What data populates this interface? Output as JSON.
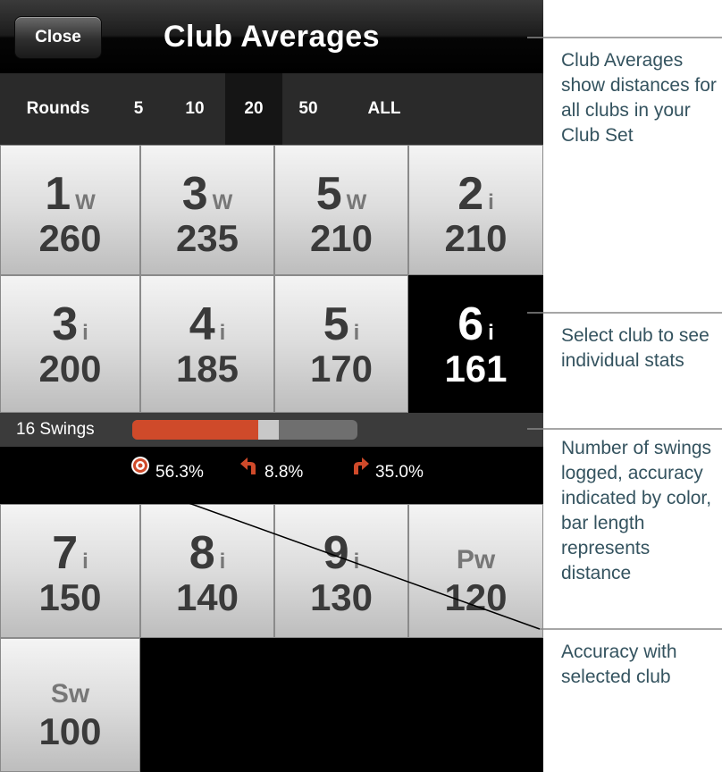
{
  "header": {
    "close_label": "Close",
    "title": "Club Averages"
  },
  "rounds": {
    "label": "Rounds",
    "options": [
      {
        "label": "5",
        "selected": false
      },
      {
        "label": "10",
        "selected": false
      },
      {
        "label": "20",
        "selected": true
      },
      {
        "label": "50",
        "selected": false
      },
      {
        "label": "ALL",
        "selected": false
      }
    ]
  },
  "clubs": [
    {
      "num": "1",
      "suffix": "W",
      "distance": "260",
      "selected": false
    },
    {
      "num": "3",
      "suffix": "W",
      "distance": "235",
      "selected": false
    },
    {
      "num": "5",
      "suffix": "W",
      "distance": "210",
      "selected": false
    },
    {
      "num": "2",
      "suffix": "i",
      "distance": "210",
      "selected": false
    },
    {
      "num": "3",
      "suffix": "i",
      "distance": "200",
      "selected": false
    },
    {
      "num": "4",
      "suffix": "i",
      "distance": "185",
      "selected": false
    },
    {
      "num": "5",
      "suffix": "i",
      "distance": "170",
      "selected": false
    },
    {
      "num": "6",
      "suffix": "i",
      "distance": "161",
      "selected": true
    },
    {
      "num": "7",
      "suffix": "i",
      "distance": "150",
      "selected": false
    },
    {
      "num": "8",
      "suffix": "i",
      "distance": "140",
      "selected": false
    },
    {
      "num": "9",
      "suffix": "i",
      "distance": "130",
      "selected": false
    },
    {
      "num": "",
      "suffix": "Pw",
      "distance": "120",
      "selected": false
    },
    {
      "num": "",
      "suffix": "Sw",
      "distance": "100",
      "selected": false
    }
  ],
  "swings": {
    "label": "16 Swings",
    "accurate_fraction": 0.56,
    "neutral_fraction": 0.09
  },
  "accuracy": {
    "on_target": "56.3%",
    "left": "8.8%",
    "right": "35.0%"
  },
  "colors": {
    "accent": "#cf4a2a",
    "annotation_text": "#34535f"
  },
  "annotations": [
    "Club Averages show distances for all clubs in your Club Set",
    "Select club to see individual stats",
    "Number of swings logged, accuracy indicated by color, bar length represents distance",
    "Accuracy with selected club"
  ]
}
